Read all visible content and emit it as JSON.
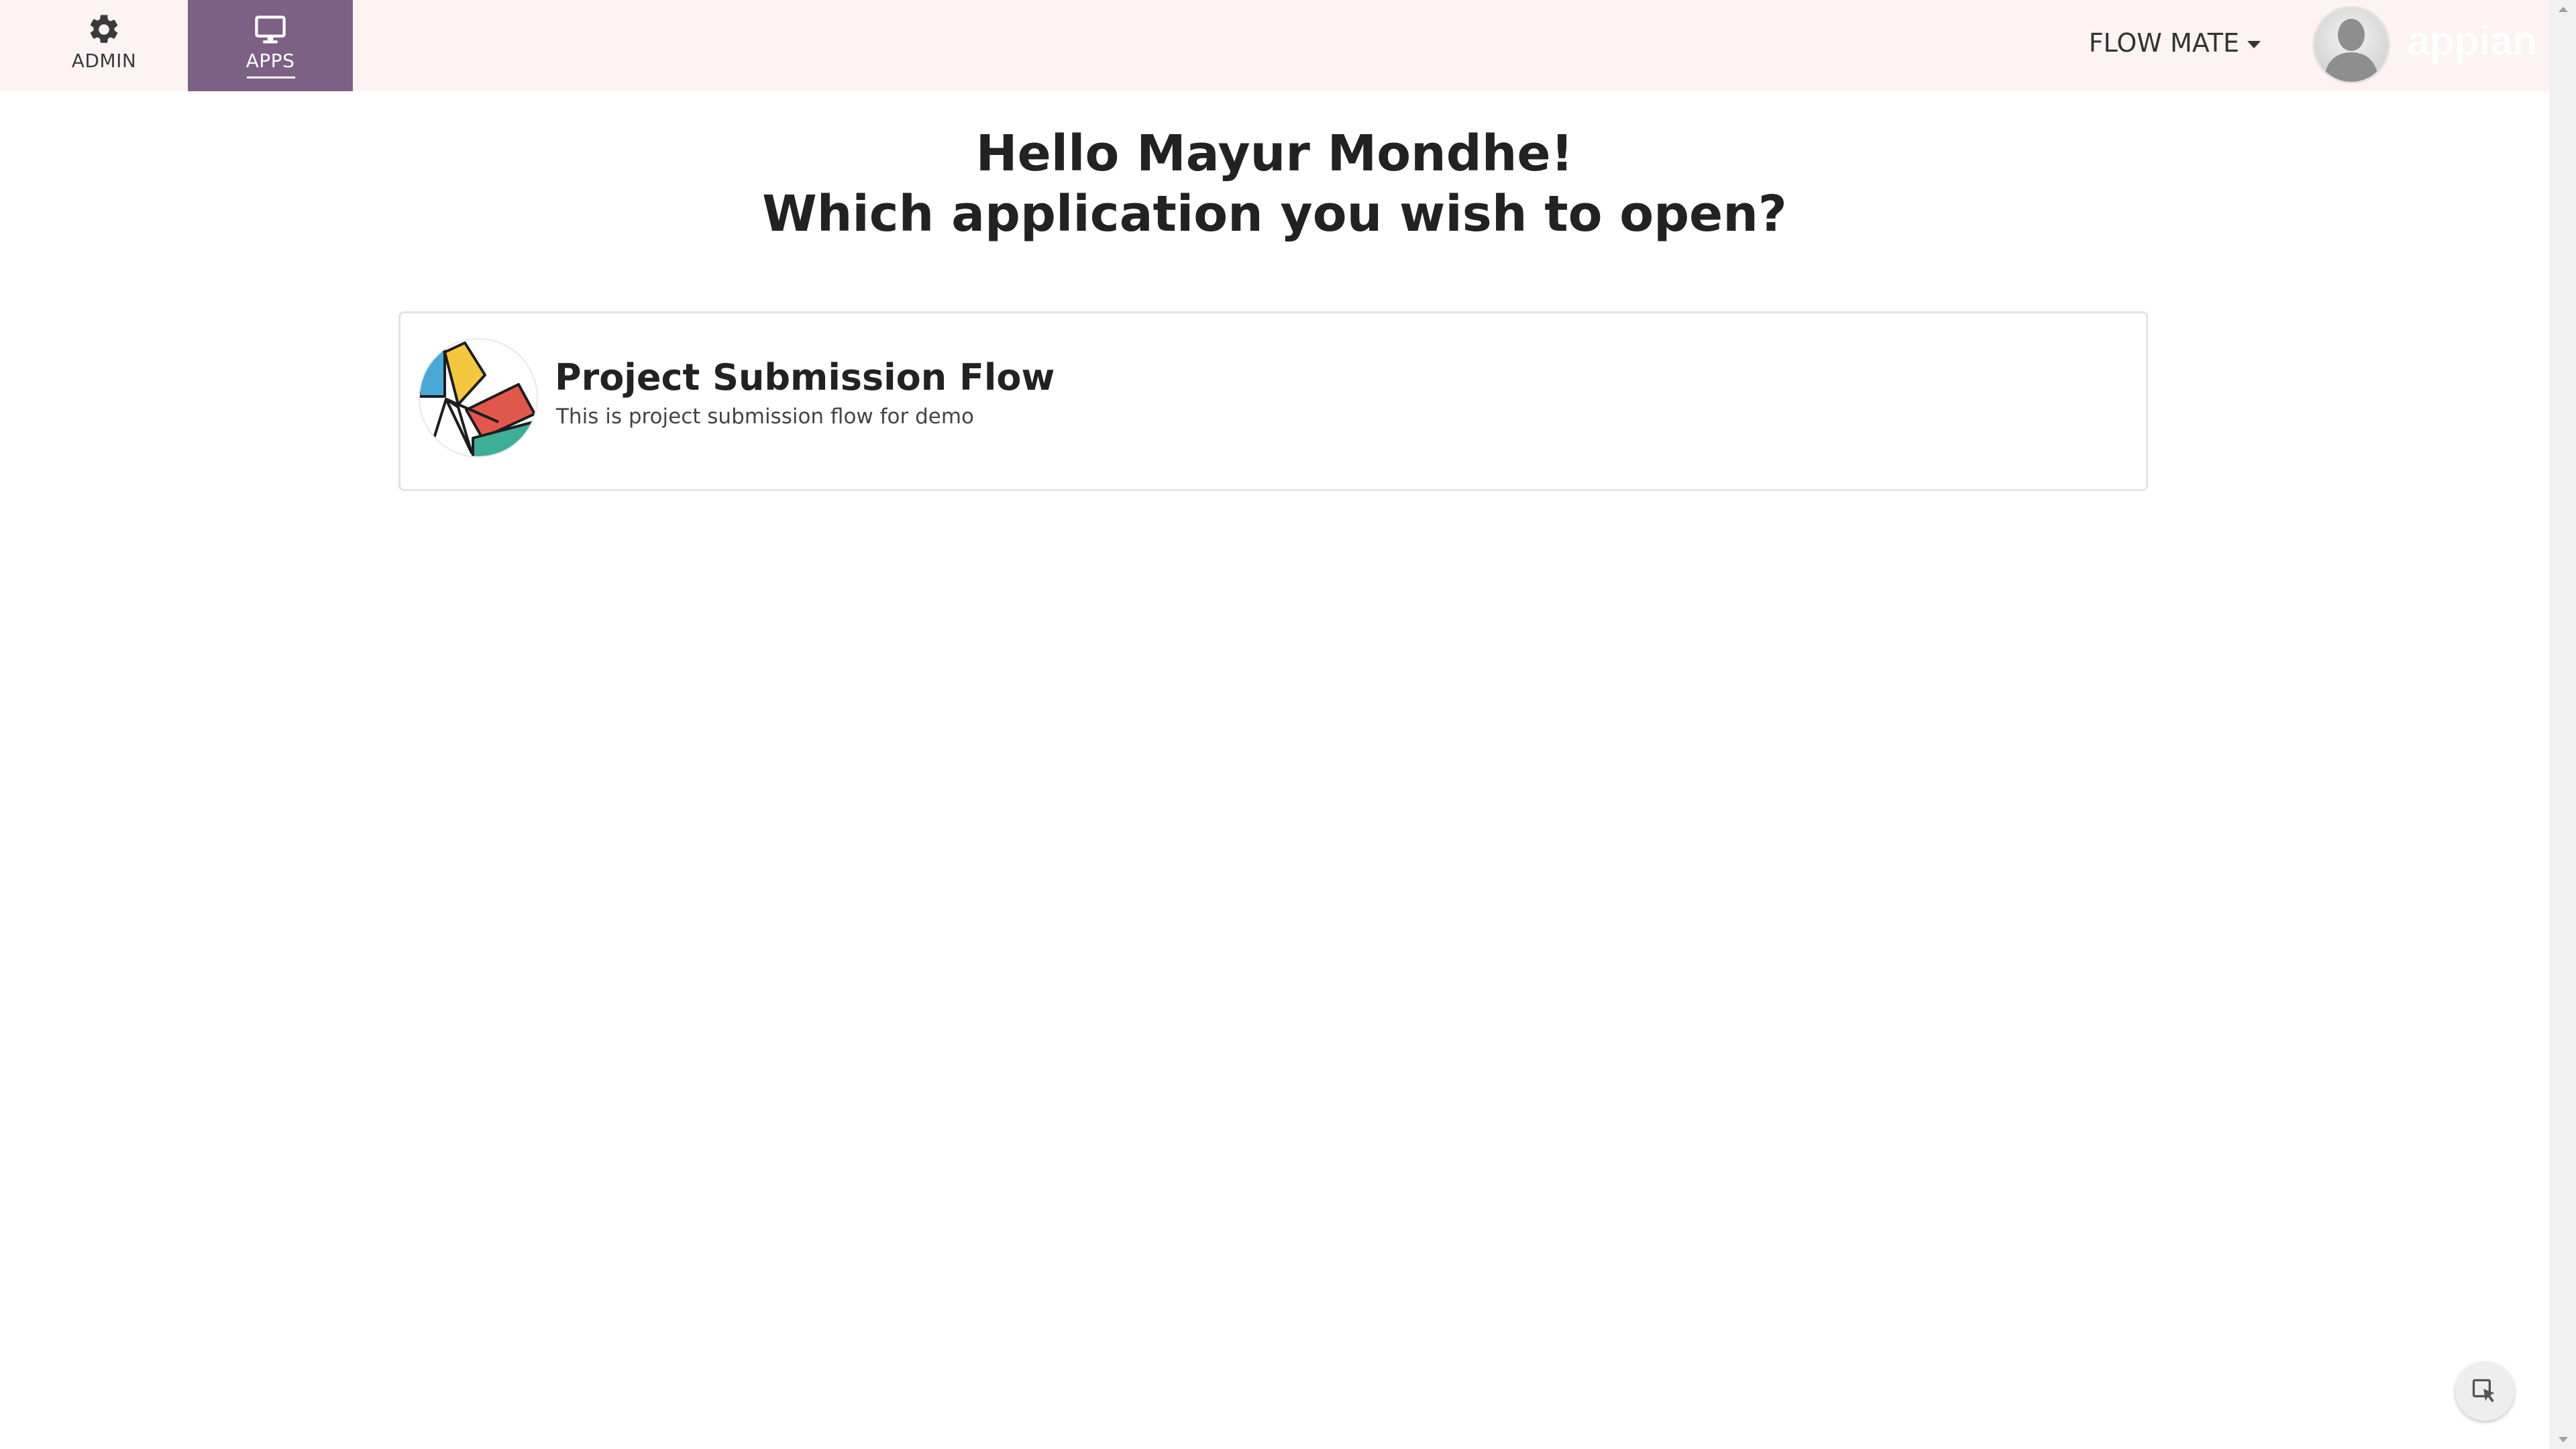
{
  "nav": {
    "admin": {
      "label": "ADMIN",
      "icon": "gear-icon"
    },
    "apps": {
      "label": "APPS",
      "icon": "monitor-icon",
      "active": true
    }
  },
  "header": {
    "site_name": "FLOW MATE",
    "brand": "appian"
  },
  "greeting": {
    "line1": "Hello Mayur Mondhe!",
    "line2": "Which application you wish to open?"
  },
  "apps": [
    {
      "title": "Project Submission Flow",
      "description": "This is project submission flow for demo",
      "icon": "app-logo-icon"
    }
  ],
  "colors": {
    "topbar": "#fdf3f3",
    "active_tab": "#7c6184",
    "logo_blue": "#4aa8d8",
    "logo_yellow": "#f3c83e",
    "logo_red": "#e2574c",
    "logo_teal": "#3fae96"
  }
}
